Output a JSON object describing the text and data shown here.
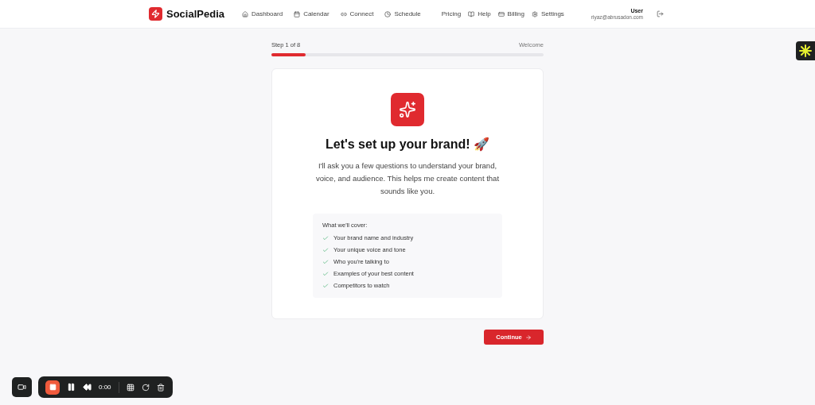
{
  "brand": {
    "name": "SocialPedia"
  },
  "nav": [
    {
      "label": "Dashboard"
    },
    {
      "label": "Calendar"
    },
    {
      "label": "Connect"
    },
    {
      "label": "Schedule"
    }
  ],
  "nav_right": [
    {
      "label": "Pricing"
    },
    {
      "label": "Help"
    },
    {
      "label": "Billing"
    },
    {
      "label": "Settings"
    }
  ],
  "user": {
    "name": "User",
    "email": "riyaz@abrusadon.com"
  },
  "progress": {
    "step": "Step 1 of 8",
    "section": "Welcome",
    "level": 0.125
  },
  "card": {
    "title": "Let's set up your brand! 🚀",
    "intro": "I'll ask you a few questions to understand your brand, voice, and audience. This helps me create content that sounds like you.",
    "cover_title": "What we'll cover:",
    "cover_items": [
      "Your brand name and industry",
      "Your unique voice and tone",
      "Who you're talking to",
      "Examples of your best content",
      "Competitors to watch"
    ]
  },
  "continue_button": "Continue",
  "recorder": {
    "time": "0:00"
  }
}
